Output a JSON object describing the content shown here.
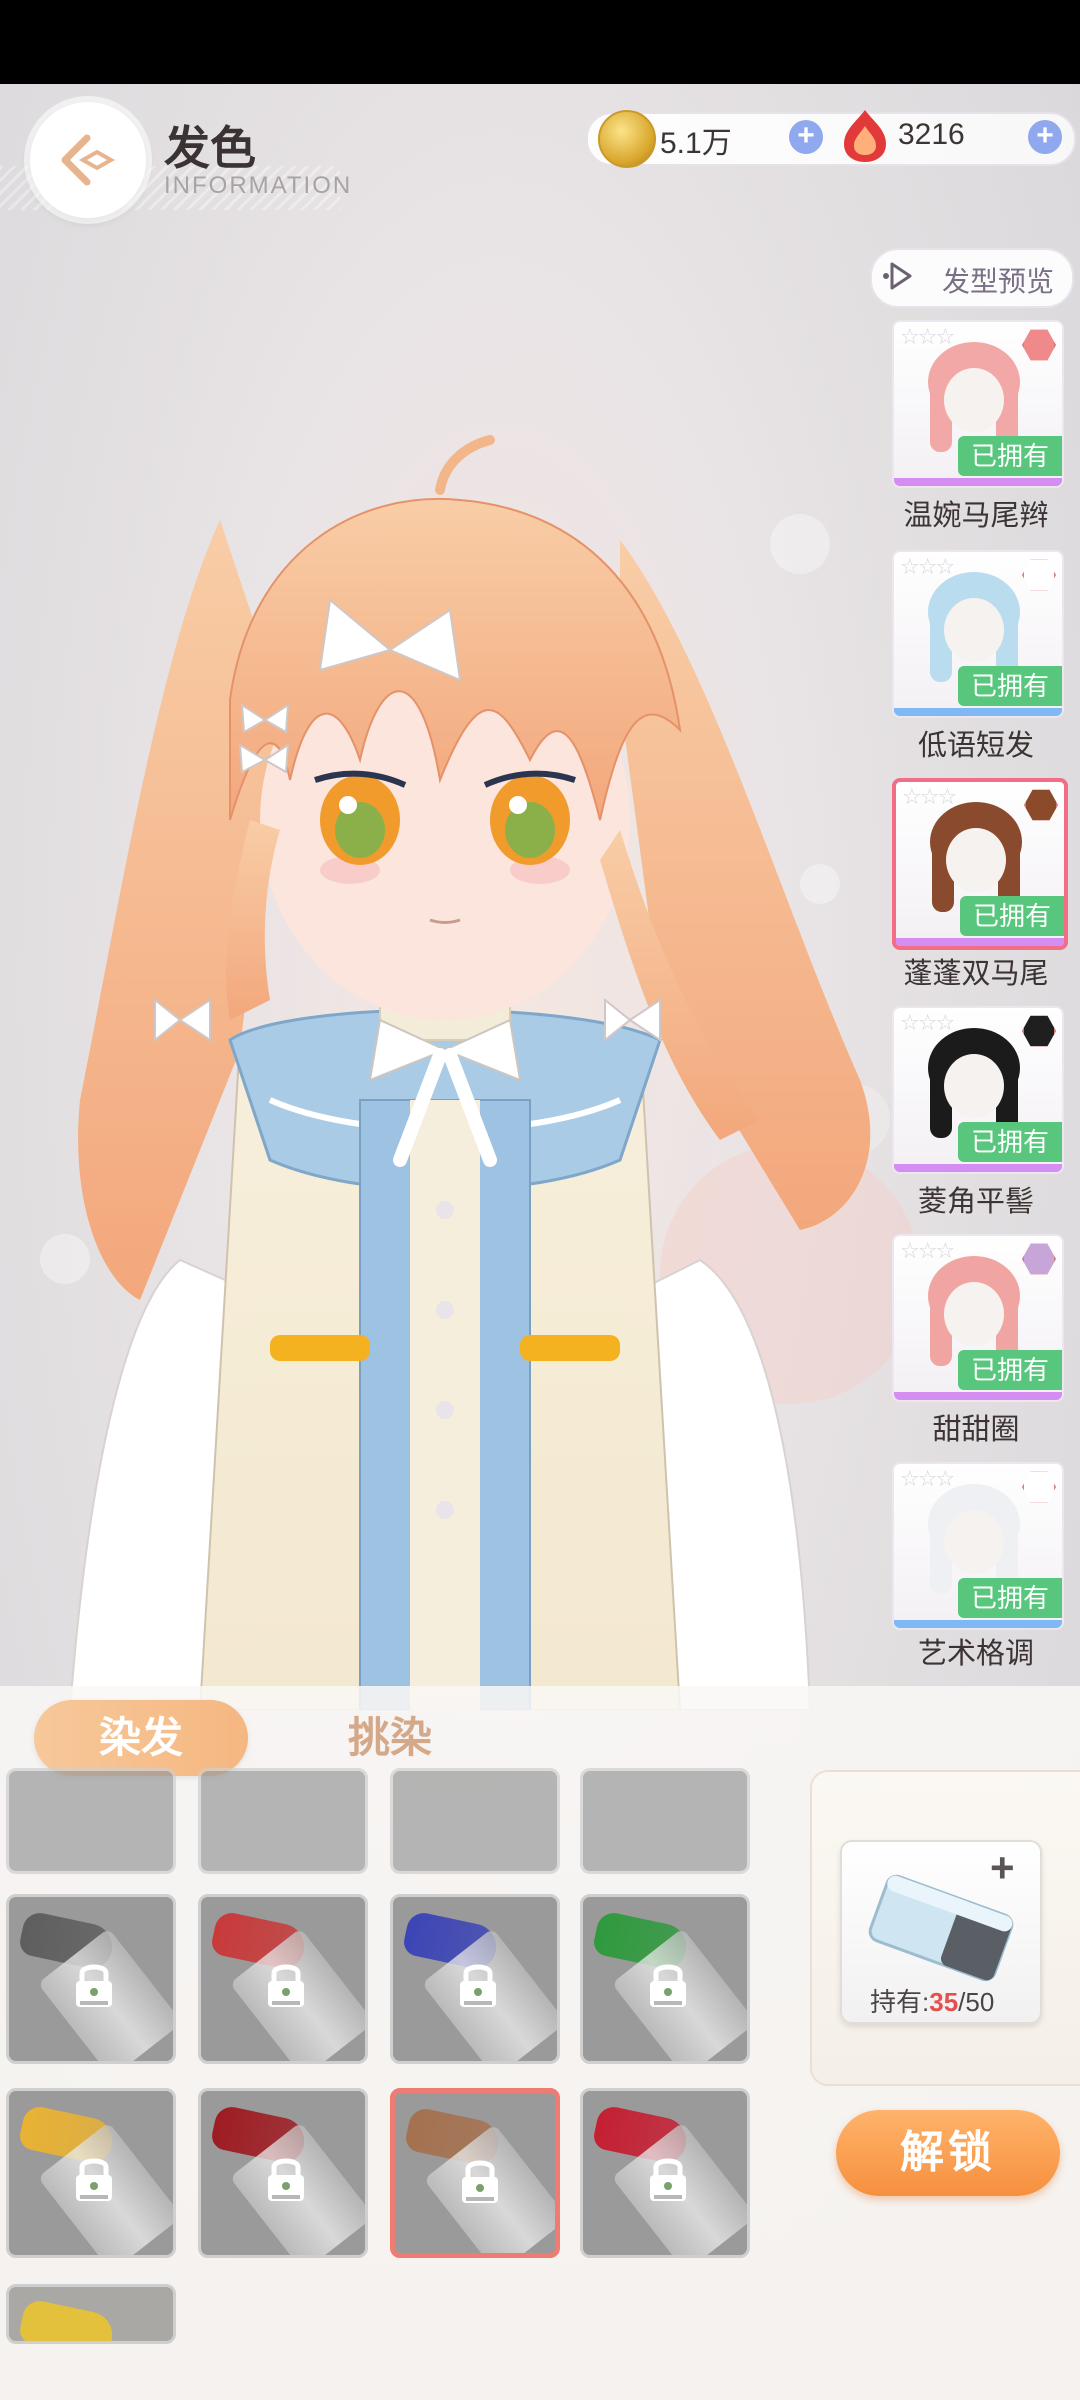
{
  "header": {
    "title": "发色",
    "subtitle": "INFORMATION"
  },
  "currency": {
    "coins": "5.1万",
    "gems": "3216"
  },
  "preview": {
    "label": "发型预览"
  },
  "hairstyles": [
    {
      "name": "温婉马尾辫",
      "status": "已拥有",
      "hair_color": "#f2a8a6",
      "badge_color": "#f08a8a",
      "rarity_color": "#d48df0",
      "selected": false
    },
    {
      "name": "低语短发",
      "status": "已拥有",
      "hair_color": "#b9dcef",
      "badge_color": "#ffffff",
      "rarity_color": "#7fb8f5",
      "selected": false
    },
    {
      "name": "蓬蓬双马尾",
      "status": "已拥有",
      "hair_color": "#8a4a2e",
      "badge_color": "#8b4a2a",
      "rarity_color": "#d48df0",
      "selected": true
    },
    {
      "name": "菱角平髻",
      "status": "已拥有",
      "hair_color": "#1b1b1b",
      "badge_color": "#1f1f1f",
      "rarity_color": "#d48df0",
      "selected": false
    },
    {
      "name": "甜甜圈",
      "status": "已拥有",
      "hair_color": "#f1a5a2",
      "badge_color": "#c8a5d8",
      "rarity_color": "#d48df0",
      "selected": false
    },
    {
      "name": "艺术格调",
      "status": "已拥有",
      "hair_color": "#eef0f3",
      "badge_color": "#ffffff",
      "rarity_color": "#7fb8f5",
      "selected": false
    }
  ],
  "tabs": {
    "dye": "染发",
    "highlight": "挑染"
  },
  "colors": [
    {
      "swatch": "#5e5e5e",
      "locked": true,
      "selected": false
    },
    {
      "swatch": "#c83a3a",
      "locked": true,
      "selected": false
    },
    {
      "swatch": "#3c45b6",
      "locked": true,
      "selected": false
    },
    {
      "swatch": "#2f9a3e",
      "locked": true,
      "selected": false
    },
    {
      "swatch": "#e9b233",
      "locked": true,
      "selected": false
    },
    {
      "swatch": "#9e1c22",
      "locked": true,
      "selected": false
    },
    {
      "swatch": "#a5714f",
      "locked": true,
      "selected": true
    },
    {
      "swatch": "#c51f33",
      "locked": true,
      "selected": false
    }
  ],
  "item": {
    "count_label": "持有:",
    "count_current": "35",
    "count_total": "/50"
  },
  "unlock_button": "解锁"
}
